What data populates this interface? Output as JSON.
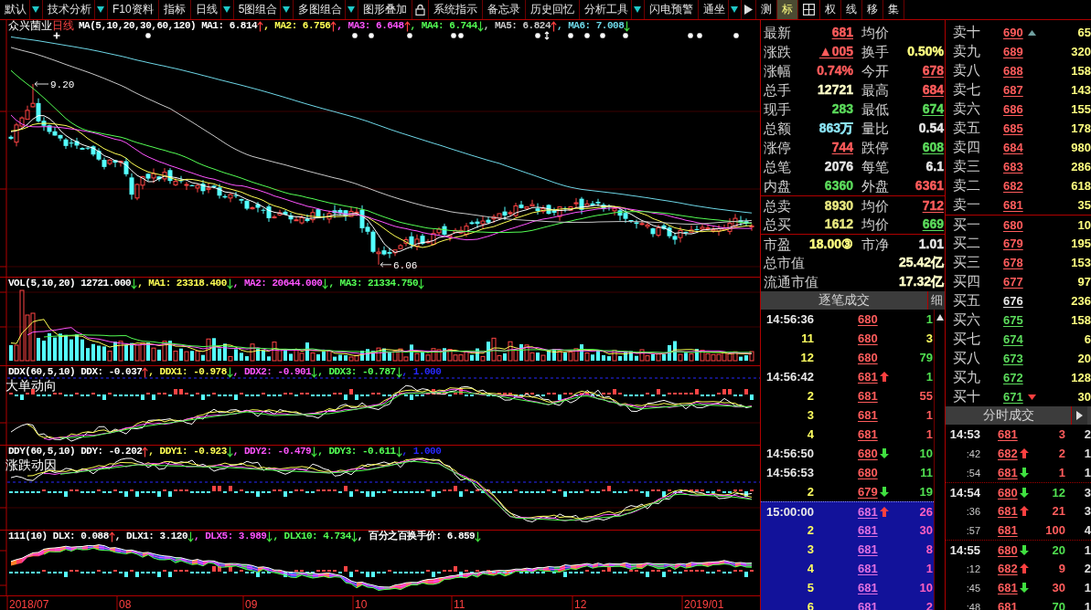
{
  "toolbar": {
    "menus": [
      {
        "label": "默认",
        "has_menu": true
      },
      {
        "label": "技术分析",
        "has_menu": true
      },
      {
        "label": "F10资料",
        "has_menu": false
      },
      {
        "label": "指标",
        "has_menu": false
      },
      {
        "label": "日线",
        "has_menu": true
      },
      {
        "label": "5图组合",
        "has_menu": true
      },
      {
        "label": "多图组合",
        "has_menu": true
      },
      {
        "label": "图形叠加",
        "has_menu": false
      }
    ],
    "menus_after_lock": [
      {
        "label": "系统指示",
        "has_menu": false
      },
      {
        "label": "备忘录",
        "has_menu": false
      },
      {
        "label": "历史回忆",
        "has_menu": false
      },
      {
        "label": "分析工具",
        "has_menu": true
      },
      {
        "label": "闪电预警",
        "has_menu": false
      },
      {
        "label": "通坐",
        "has_menu": true
      }
    ],
    "tools": [
      {
        "label": "测",
        "selected": false
      },
      {
        "label": "标",
        "selected": true
      }
    ],
    "tools_after_grid": [
      {
        "label": "权",
        "selected": false
      },
      {
        "label": "线",
        "selected": false
      },
      {
        "label": "移",
        "selected": false
      },
      {
        "label": "集",
        "selected": false
      }
    ]
  },
  "price_chart": {
    "stock_name": "众兴菌业",
    "period": "日线",
    "title": "MA(5,10,20,30,60,120)",
    "values": [
      {
        "text": "MA1: 6.814",
        "rising": true,
        "falling": false,
        "color": "#ffffff"
      },
      {
        "text": ", MA2: 6.756",
        "rising": true,
        "falling": false,
        "color": "#ffff54"
      },
      {
        "text": ", MA3: 6.648",
        "rising": true,
        "falling": false,
        "color": "#ff54ff"
      },
      {
        "text": ", MA4: 6.744",
        "rising": false,
        "falling": true,
        "color": "#54ff54"
      },
      {
        "text": ", MA5: 6.824",
        "rising": true,
        "falling": false,
        "color": "#c8c8c8"
      },
      {
        "text": ", MA6: 7.008",
        "rising": false,
        "falling": true,
        "color": "#6ed8e8"
      }
    ],
    "high_label": "9.20",
    "low_label": "6.06"
  },
  "volume_chart": {
    "title": "VOL(5,10,20)",
    "values": [
      {
        "text": "12721.000",
        "rising": false,
        "falling": true,
        "color": "#ffffff",
        "kind": "bars"
      },
      {
        "text": ", MA1: 23318.400",
        "rising": false,
        "falling": true,
        "color": "#ffff54",
        "kind": "line"
      },
      {
        "text": ", MA2: 20644.000",
        "rising": false,
        "falling": true,
        "color": "#ff54ff",
        "kind": "line"
      },
      {
        "text": ", MA3: 21334.750",
        "rising": false,
        "falling": true,
        "color": "#54ff54",
        "kind": "line"
      }
    ]
  },
  "ddx_chart": {
    "title": "DDX(60,5,10)",
    "subtitle": "大单动向",
    "values": [
      {
        "text": "DDX: -0.037",
        "rising": true,
        "falling": false,
        "color": "#ffffff",
        "kind": "line"
      },
      {
        "text": ", DDX1: -0.978",
        "rising": false,
        "falling": true,
        "color": "#ffff54",
        "kind": "line"
      },
      {
        "text": ", DDX2: -0.901",
        "rising": false,
        "falling": true,
        "color": "#ff54ff",
        "kind": "line"
      },
      {
        "text": ", DDX3: -0.787",
        "rising": false,
        "falling": true,
        "color": "#54ff54",
        "kind": "line"
      },
      {
        "text": ", 1.000",
        "rising": false,
        "falling": false,
        "color": "#2828ff",
        "kind": "level"
      }
    ]
  },
  "ddy_chart": {
    "title": "DDY(60,5,10)",
    "subtitle": "涨跌动因",
    "values": [
      {
        "text": "DDY: -0.202",
        "rising": true,
        "falling": false,
        "color": "#ffffff",
        "kind": "line"
      },
      {
        "text": ", DDY1: -0.923",
        "rising": false,
        "falling": true,
        "color": "#ffff54",
        "kind": "line"
      },
      {
        "text": ", DDY2: -0.479",
        "rising": false,
        "falling": true,
        "color": "#ff54ff",
        "kind": "line"
      },
      {
        "text": ", DDY3: -0.611",
        "rising": false,
        "falling": true,
        "color": "#54ff54",
        "kind": "line"
      },
      {
        "text": ", 1.000",
        "rising": false,
        "falling": false,
        "color": "#2828ff",
        "kind": "level"
      }
    ]
  },
  "dlx_chart": {
    "title": "111(10)",
    "values": [
      {
        "text": "DLX: 0.088",
        "rising": true,
        "falling": false,
        "color": "#ffffff",
        "kind": "line"
      },
      {
        "text": ", DLX1: 3.120",
        "rising": false,
        "falling": true,
        "color": "#ffffff",
        "kind": "value"
      },
      {
        "text": ", DLX5: 3.989",
        "rising": false,
        "falling": true,
        "color": "#ff54ff",
        "kind": "line"
      },
      {
        "text": ", DLX10: 4.734",
        "rising": false,
        "falling": true,
        "color": "#54ff54",
        "kind": "line"
      },
      {
        "text": ", 百分之百换手价: 6.859",
        "rising": false,
        "falling": true,
        "color": "#ffffff",
        "kind": "value"
      }
    ]
  },
  "date_axis": [
    "2018/07",
    "08",
    "09",
    "10",
    "11",
    "12",
    "2019/01"
  ],
  "quote": {
    "sections": [
      {
        "rows": [
          {
            "cells": [
              {
                "label": "最新",
                "value": "681",
                "color": "#ff5c5c",
                "underline": true
              },
              {
                "label": "均价"
              }
            ]
          },
          {
            "cells": [
              {
                "label": "涨跌",
                "value": "▲005",
                "color": "#ff5c5c",
                "underline": true
              },
              {
                "label": "换手",
                "value": "0.50%",
                "color": "#ffff80",
                "underline": false
              }
            ]
          },
          {
            "cells": [
              {
                "label": "涨幅",
                "value": "0.74%",
                "color": "#ff5c5c",
                "underline": false
              },
              {
                "label": "今开",
                "value": "678",
                "color": "#ff5c5c",
                "underline": true
              }
            ]
          },
          {
            "cells": [
              {
                "label": "总手",
                "value": "12721",
                "color": "#ffffc8",
                "underline": false
              },
              {
                "label": "最高",
                "value": "684",
                "color": "#ff5c5c",
                "underline": true
              }
            ]
          },
          {
            "cells": [
              {
                "label": "现手",
                "value": "283",
                "color": "#5cdc5c",
                "underline": false
              },
              {
                "label": "最低",
                "value": "674",
                "color": "#5cdc5c",
                "underline": true
              }
            ]
          },
          {
            "cells": [
              {
                "label": "总额",
                "value": "863万",
                "color": "#8ce4f4",
                "underline": false
              },
              {
                "label": "量比",
                "value": "0.54",
                "color": "#e6e6e6",
                "underline": false
              }
            ]
          },
          {
            "cells": [
              {
                "label": "涨停",
                "value": "744",
                "color": "#ff5c5c",
                "underline": true
              },
              {
                "label": "跌停",
                "value": "608",
                "color": "#5cdc5c",
                "underline": true
              }
            ]
          },
          {
            "cells": [
              {
                "label": "总笔",
                "value": "2076",
                "color": "#e6e6e6",
                "underline": false
              },
              {
                "label": "每笔",
                "value": "6.1",
                "color": "#e6e6e6",
                "underline": false
              }
            ]
          },
          {
            "cells": [
              {
                "label": "内盘",
                "value": "6360",
                "color": "#5cdc5c",
                "underline": false
              },
              {
                "label": "外盘",
                "value": "6361",
                "color": "#ff5c5c",
                "underline": false
              }
            ]
          }
        ]
      },
      {
        "rows": [
          {
            "cells": [
              {
                "label": "总卖",
                "value": "8930",
                "color": "#e8e880",
                "underline": false
              },
              {
                "label": "均价",
                "value": "712",
                "color": "#ff5c5c",
                "underline": true
              }
            ]
          },
          {
            "cells": [
              {
                "label": "总买",
                "value": "1612",
                "color": "#e8e880",
                "underline": false
              },
              {
                "label": "均价",
                "value": "669",
                "color": "#5cdc5c",
                "underline": true
              }
            ]
          }
        ]
      },
      {
        "rows": [
          {
            "cells": [
              {
                "label": "市盈",
                "value": "18.00③",
                "color": "#ffff80",
                "underline": false
              },
              {
                "label": "市净",
                "value": "1.01",
                "color": "#e6e6e6",
                "underline": false
              }
            ]
          },
          {
            "cells": [
              {
                "label": "总市值",
                "value": "25.42亿",
                "color": "#ffffc8",
                "underline": false
              }
            ]
          },
          {
            "cells": [
              {
                "label": "流通市值",
                "value": "17.32亿",
                "color": "#ffffc8",
                "underline": false
              }
            ]
          }
        ]
      }
    ]
  },
  "order_book": {
    "more_above": true,
    "asks": [
      {
        "label": "卖十",
        "price": "690",
        "volume": "65",
        "color": "#ff5c5c"
      },
      {
        "label": "卖九",
        "price": "689",
        "volume": "320",
        "color": "#ff5c5c"
      },
      {
        "label": "卖八",
        "price": "688",
        "volume": "158",
        "color": "#ff5c5c"
      },
      {
        "label": "卖七",
        "price": "687",
        "volume": "143",
        "color": "#ff5c5c"
      },
      {
        "label": "卖六",
        "price": "686",
        "volume": "155",
        "color": "#ff5c5c"
      },
      {
        "label": "卖五",
        "price": "685",
        "volume": "178",
        "color": "#ff5c5c"
      },
      {
        "label": "卖四",
        "price": "684",
        "volume": "980",
        "color": "#ff5c5c"
      },
      {
        "label": "卖三",
        "price": "683",
        "volume": "286",
        "color": "#ff5c5c"
      },
      {
        "label": "卖二",
        "price": "682",
        "volume": "618",
        "color": "#ff5c5c"
      },
      {
        "label": "卖一",
        "price": "681",
        "volume": "35",
        "color": "#ff5c5c"
      }
    ],
    "bids": [
      {
        "label": "买一",
        "price": "680",
        "volume": "10",
        "color": "#ff5c5c"
      },
      {
        "label": "买二",
        "price": "679",
        "volume": "195",
        "color": "#ff5c5c"
      },
      {
        "label": "买三",
        "price": "678",
        "volume": "153",
        "color": "#ff5c5c"
      },
      {
        "label": "买四",
        "price": "677",
        "volume": "97",
        "color": "#ff5c5c"
      },
      {
        "label": "买五",
        "price": "676",
        "volume": "236",
        "color": "#e6e6e6"
      },
      {
        "label": "买六",
        "price": "675",
        "volume": "158",
        "color": "#5cdc5c"
      },
      {
        "label": "买七",
        "price": "674",
        "volume": "6",
        "color": "#5cdc5c"
      },
      {
        "label": "买八",
        "price": "673",
        "volume": "20",
        "color": "#5cdc5c"
      },
      {
        "label": "买九",
        "price": "672",
        "volume": "128",
        "color": "#5cdc5c"
      },
      {
        "label": "买十",
        "price": "671",
        "volume": "30",
        "color": "#5cdc5c"
      }
    ],
    "more_below": true
  },
  "tick_list": {
    "title": "逐笔成交",
    "detail_button": "细",
    "rows": [
      {
        "time": "14:56:36",
        "kind": "full",
        "price": "680",
        "rising": false,
        "falling": false,
        "volume": "1",
        "color": "#50e050",
        "highlighted": false
      },
      {
        "time": "11",
        "kind": "repeat",
        "price": "680",
        "rising": false,
        "falling": false,
        "volume": "3",
        "color": "#ffff60",
        "highlighted": false
      },
      {
        "time": "12",
        "kind": "repeat",
        "price": "680",
        "rising": false,
        "falling": false,
        "volume": "79",
        "color": "#50e050",
        "highlighted": false
      },
      {
        "time": "14:56:42",
        "kind": "full",
        "price": "681",
        "rising": true,
        "falling": false,
        "volume": "1",
        "color": "#50e050",
        "highlighted": false
      },
      {
        "time": "2",
        "kind": "repeat",
        "price": "681",
        "rising": false,
        "falling": false,
        "volume": "55",
        "color": "#ff5c5c",
        "highlighted": false
      },
      {
        "time": "3",
        "kind": "repeat",
        "price": "681",
        "rising": false,
        "falling": false,
        "volume": "1",
        "color": "#ff5c5c",
        "highlighted": false
      },
      {
        "time": "4",
        "kind": "repeat",
        "price": "681",
        "rising": false,
        "falling": false,
        "volume": "1",
        "color": "#ff5c5c",
        "highlighted": false
      },
      {
        "time": "14:56:50",
        "kind": "full",
        "price": "680",
        "rising": false,
        "falling": true,
        "volume": "10",
        "color": "#50e050",
        "highlighted": false
      },
      {
        "time": "14:56:53",
        "kind": "full",
        "price": "680",
        "rising": false,
        "falling": false,
        "volume": "11",
        "color": "#50e050",
        "highlighted": false
      },
      {
        "time": "2",
        "kind": "repeat",
        "price": "679",
        "rising": false,
        "falling": true,
        "volume": "19",
        "color": "#50e050",
        "highlighted": false
      },
      {
        "time": "15:00:00",
        "kind": "full",
        "price": "681",
        "rising": true,
        "falling": false,
        "volume": "26",
        "color": "#ff60c0",
        "highlighted": true
      },
      {
        "time": "2",
        "kind": "repeat",
        "price": "681",
        "rising": false,
        "falling": false,
        "volume": "30",
        "color": "#ff60c0",
        "highlighted": true
      },
      {
        "time": "3",
        "kind": "repeat",
        "price": "681",
        "rising": false,
        "falling": false,
        "volume": "8",
        "color": "#ff60c0",
        "highlighted": true
      },
      {
        "time": "4",
        "kind": "repeat",
        "price": "681",
        "rising": false,
        "falling": false,
        "volume": "1",
        "color": "#ff60c0",
        "highlighted": true
      },
      {
        "time": "5",
        "kind": "repeat",
        "price": "681",
        "rising": false,
        "falling": false,
        "volume": "10",
        "color": "#ff60c0",
        "highlighted": true
      },
      {
        "time": "6",
        "kind": "repeat",
        "price": "681",
        "rising": false,
        "falling": false,
        "volume": "2",
        "color": "#ff60c0",
        "highlighted": true
      }
    ]
  },
  "minute_trades": {
    "title": "分时成交",
    "groups": [
      {
        "rows": [
          {
            "time": "14:53",
            "kind": "minute",
            "price": "681",
            "rising": false,
            "falling": false,
            "volume": "3",
            "color": "#ff5c5c",
            "column_4": "2"
          },
          {
            "time": ":42",
            "kind": "second",
            "price": "682",
            "rising": true,
            "falling": false,
            "volume": "2",
            "color": "#ff5c5c",
            "column_4": "1"
          },
          {
            "time": ":54",
            "kind": "second",
            "price": "681",
            "rising": false,
            "falling": true,
            "volume": "1",
            "color": "#ff5c5c",
            "column_4": "1"
          }
        ]
      },
      {
        "rows": [
          {
            "time": "14:54",
            "kind": "minute",
            "price": "680",
            "rising": false,
            "falling": true,
            "volume": "12",
            "color": "#50e050",
            "column_4": "3"
          },
          {
            "time": ":36",
            "kind": "second",
            "price": "681",
            "rising": true,
            "falling": false,
            "volume": "21",
            "color": "#ff5c5c",
            "column_4": "3"
          },
          {
            "time": ":57",
            "kind": "second",
            "price": "681",
            "rising": false,
            "falling": false,
            "volume": "100",
            "color": "#ff5c5c",
            "column_4": "4"
          }
        ]
      },
      {
        "rows": [
          {
            "time": "14:55",
            "kind": "minute",
            "price": "680",
            "rising": false,
            "falling": true,
            "volume": "20",
            "color": "#50e050",
            "column_4": "1"
          },
          {
            "time": ":12",
            "kind": "second",
            "price": "682",
            "rising": true,
            "falling": false,
            "volume": "9",
            "color": "#ff5c5c",
            "column_4": "2"
          },
          {
            "time": ":45",
            "kind": "second",
            "price": "681",
            "rising": false,
            "falling": true,
            "volume": "30",
            "color": "#ff5c5c",
            "column_4": "1"
          },
          {
            "time": ":48",
            "kind": "second",
            "price": "681",
            "rising": false,
            "falling": false,
            "volume": "70",
            "color": "#50e050",
            "column_4": "1"
          }
        ]
      }
    ]
  }
}
